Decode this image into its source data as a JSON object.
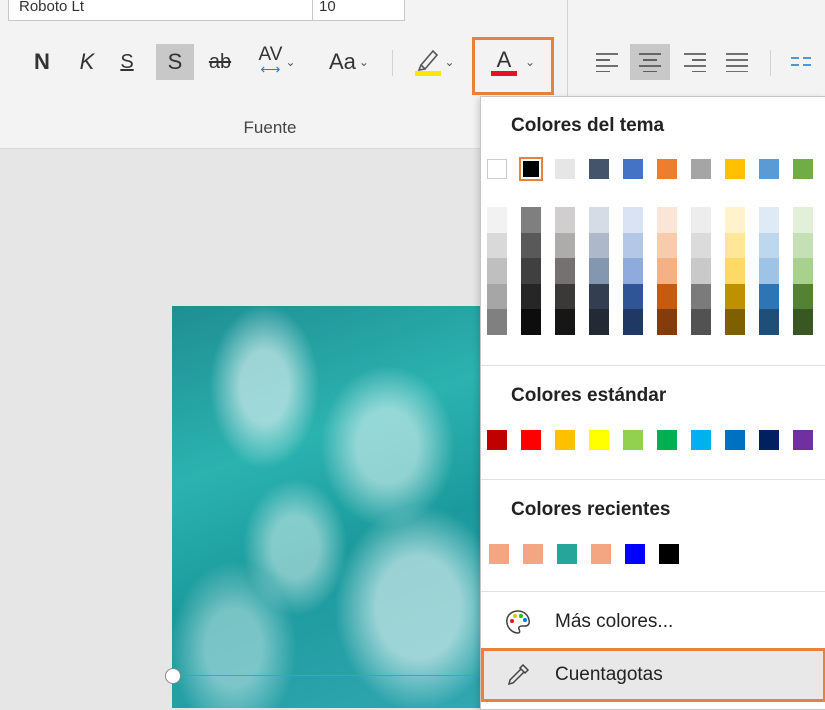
{
  "ribbon": {
    "font_name_partial": "Roboto Lt",
    "font_size_partial": "10",
    "buttons": {
      "bold": "N",
      "italic": "K",
      "underline": "S",
      "shadow": "S",
      "strikethrough": "ab",
      "spacing": "AV",
      "case": "Aa",
      "font_color": "A"
    },
    "group_label": "Fuente",
    "font_color_bar": "#e81123",
    "highlight_bar": "#ffe600"
  },
  "menu": {
    "theme_title": "Colores del tema",
    "theme_base": [
      "#ffffff",
      "#000000",
      "#e7e6e6",
      "#44546a",
      "#4472c4",
      "#ed7d31",
      "#a5a5a5",
      "#ffc000",
      "#5b9bd5",
      "#70ad47"
    ],
    "theme_shades": [
      [
        "#f2f2f2",
        "#d9d9d9",
        "#bfbfbf",
        "#a6a6a6",
        "#808080"
      ],
      [
        "#7f7f7f",
        "#595959",
        "#404040",
        "#262626",
        "#0d0d0d"
      ],
      [
        "#d0cece",
        "#aeabab",
        "#757171",
        "#3b3838",
        "#171616"
      ],
      [
        "#d6dce5",
        "#adb9ca",
        "#8497b0",
        "#333f50",
        "#222a35"
      ],
      [
        "#dae3f3",
        "#b4c7e7",
        "#8faadc",
        "#2f5597",
        "#1f3864"
      ],
      [
        "#fbe5d6",
        "#f8cbad",
        "#f4b183",
        "#c55a11",
        "#843c0c"
      ],
      [
        "#ededed",
        "#dbdbdb",
        "#c9c9c9",
        "#7b7b7b",
        "#525252"
      ],
      [
        "#fff2cc",
        "#ffe699",
        "#ffd966",
        "#bf9000",
        "#7f6000"
      ],
      [
        "#deebf7",
        "#bdd7ee",
        "#9dc3e6",
        "#2e75b6",
        "#1f4e79"
      ],
      [
        "#e2f0d9",
        "#c5e0b4",
        "#a9d18e",
        "#548235",
        "#385723"
      ]
    ],
    "standard_title": "Colores estándar",
    "standard_colors": [
      "#c00000",
      "#ff0000",
      "#ffc000",
      "#ffff00",
      "#92d050",
      "#00b050",
      "#00b0f0",
      "#0070c0",
      "#002060",
      "#7030a0"
    ],
    "recent_title": "Colores recientes",
    "recent_colors": [
      "#f4a582",
      "#f4a582",
      "#26a69a",
      "#f4a582",
      "#0000ff",
      "#000000"
    ],
    "more_colors": "Más colores...",
    "eyedropper": "Cuentagotas"
  }
}
